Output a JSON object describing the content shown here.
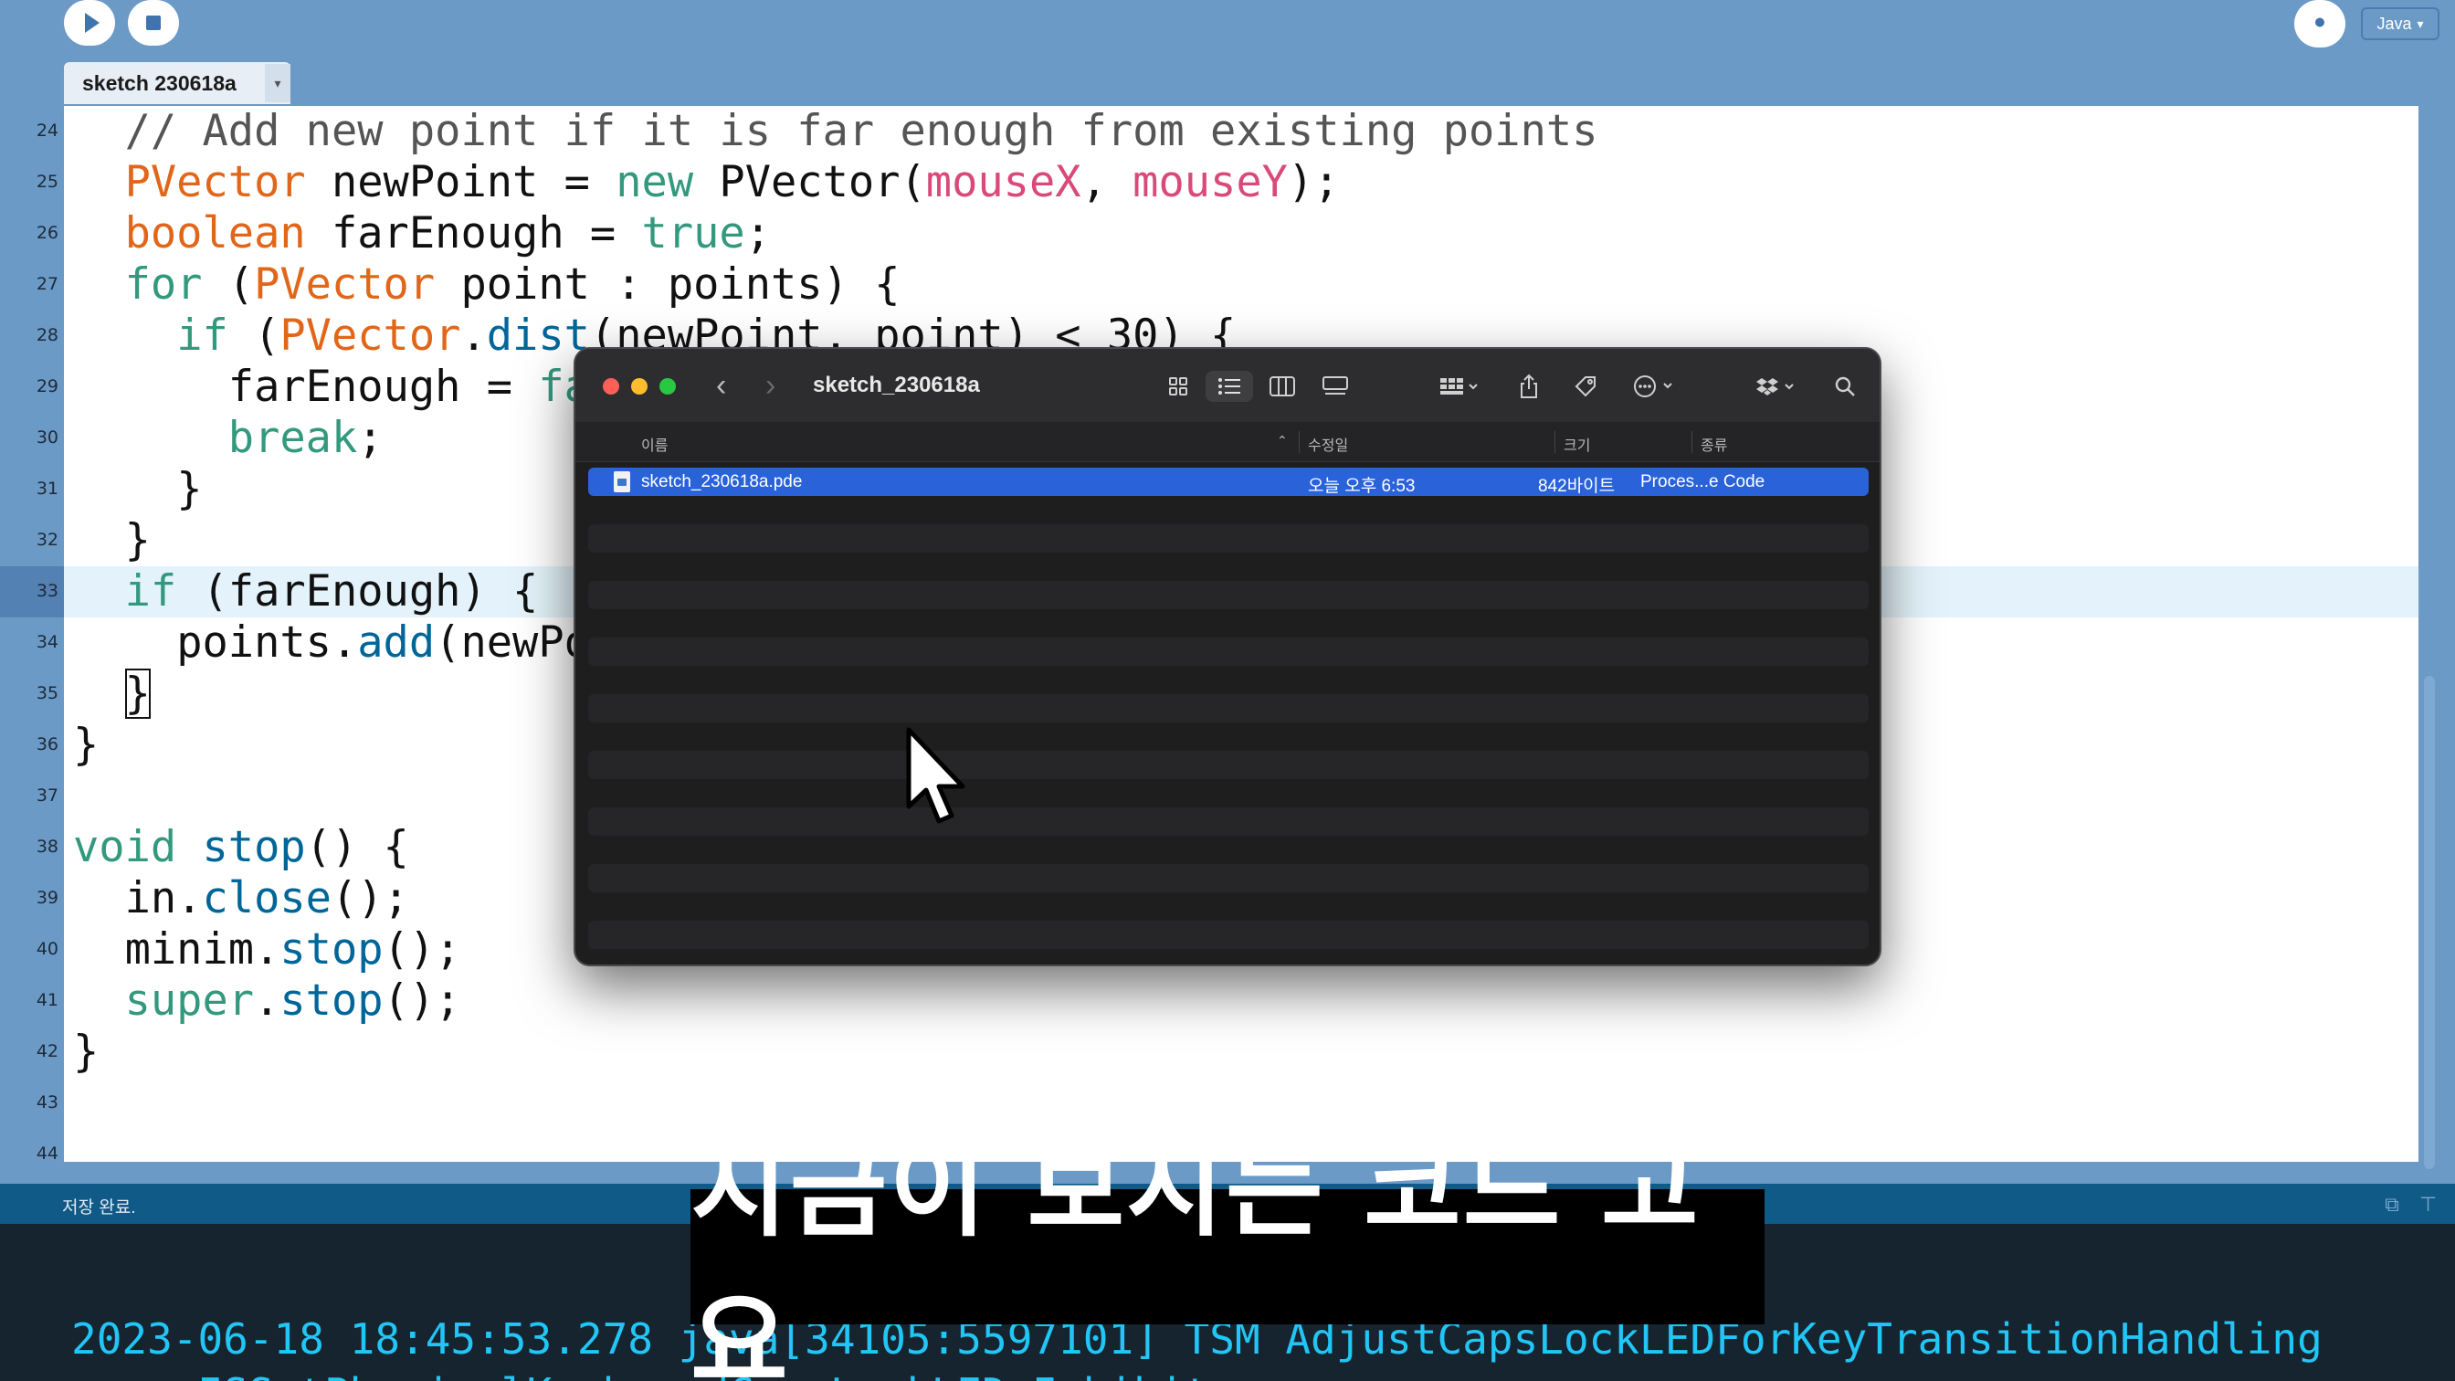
{
  "toolbar": {
    "run_icon": "play-icon",
    "stop_icon": "stop-icon",
    "debug_icon": "debugger-icon",
    "debug_glyph": "ꔷ",
    "mode_label": "Java",
    "mode_arrow": "▾"
  },
  "tab": {
    "label": "sketch 230618a",
    "arrow": "▾"
  },
  "editor": {
    "lines": [
      {
        "num": "24",
        "indent": 2,
        "tokens": [
          [
            "cmt",
            "// Add new point if it is far enough from existing points"
          ]
        ]
      },
      {
        "num": "25",
        "indent": 2,
        "tokens": [
          [
            "type",
            "PVector"
          ],
          [
            "plain",
            " newPoint = "
          ],
          [
            "kw",
            "new"
          ],
          [
            "plain",
            " PVector("
          ],
          [
            "var",
            "mouseX"
          ],
          [
            "plain",
            ", "
          ],
          [
            "var",
            "mouseY"
          ],
          [
            "plain",
            ");"
          ]
        ]
      },
      {
        "num": "26",
        "indent": 2,
        "tokens": [
          [
            "type",
            "boolean"
          ],
          [
            "plain",
            " farEnough = "
          ],
          [
            "kw",
            "true"
          ],
          [
            "plain",
            ";"
          ]
        ]
      },
      {
        "num": "27",
        "indent": 2,
        "tokens": [
          [
            "kw",
            "for"
          ],
          [
            "plain",
            " ("
          ],
          [
            "type",
            "PVector"
          ],
          [
            "plain",
            " point : points) {"
          ]
        ]
      },
      {
        "num": "28",
        "indent": 4,
        "tokens": [
          [
            "kw",
            "if"
          ],
          [
            "plain",
            " ("
          ],
          [
            "type",
            "PVector"
          ],
          [
            "plain",
            "."
          ],
          [
            "fn",
            "dist"
          ],
          [
            "plain",
            "(newPoint, point) < 30) {"
          ]
        ]
      },
      {
        "num": "29",
        "indent": 6,
        "tokens": [
          [
            "plain",
            "farEnough = "
          ],
          [
            "kw",
            "false"
          ],
          [
            "plain",
            ";"
          ]
        ]
      },
      {
        "num": "30",
        "indent": 6,
        "tokens": [
          [
            "kw",
            "break"
          ],
          [
            "plain",
            ";"
          ]
        ]
      },
      {
        "num": "31",
        "indent": 4,
        "tokens": [
          [
            "plain",
            "}"
          ]
        ]
      },
      {
        "num": "32",
        "indent": 2,
        "tokens": [
          [
            "plain",
            "}"
          ]
        ]
      },
      {
        "num": "33",
        "indent": 2,
        "current": true,
        "tokens": [
          [
            "kw",
            "if"
          ],
          [
            "plain",
            " (farEnough) {"
          ]
        ]
      },
      {
        "num": "34",
        "indent": 4,
        "tokens": [
          [
            "plain",
            "points."
          ],
          [
            "fn",
            "add"
          ],
          [
            "plain",
            "(newPoint);"
          ]
        ]
      },
      {
        "num": "35",
        "indent": 2,
        "cursor": true,
        "tokens": [
          [
            "plain",
            "}"
          ]
        ]
      },
      {
        "num": "36",
        "indent": 0,
        "tokens": [
          [
            "plain",
            "}"
          ]
        ]
      },
      {
        "num": "37",
        "indent": 0,
        "tokens": []
      },
      {
        "num": "38",
        "indent": 0,
        "tokens": [
          [
            "kw",
            "void"
          ],
          [
            "plain",
            " "
          ],
          [
            "fn",
            "stop"
          ],
          [
            "plain",
            "() {"
          ]
        ]
      },
      {
        "num": "39",
        "indent": 2,
        "tokens": [
          [
            "plain",
            "in."
          ],
          [
            "fn",
            "close"
          ],
          [
            "plain",
            "();"
          ]
        ]
      },
      {
        "num": "40",
        "indent": 2,
        "tokens": [
          [
            "plain",
            "minim."
          ],
          [
            "fn",
            "stop"
          ],
          [
            "plain",
            "();"
          ]
        ]
      },
      {
        "num": "41",
        "indent": 2,
        "tokens": [
          [
            "kw",
            "super"
          ],
          [
            "plain",
            "."
          ],
          [
            "fn",
            "stop"
          ],
          [
            "plain",
            "();"
          ]
        ]
      },
      {
        "num": "42",
        "indent": 0,
        "tokens": [
          [
            "plain",
            "}"
          ]
        ]
      },
      {
        "num": "43",
        "indent": 0,
        "tokens": []
      },
      {
        "num": "44",
        "indent": 0,
        "tokens": []
      }
    ]
  },
  "status": {
    "text": "저장 완료."
  },
  "console": {
    "lines": [
      "2023-06-18 18:45:53.278 java[34105:5597101] TSM AdjustCapsLockLEDForKeyTransitionHandling",
      "  - _ISSetPhysicalKeyboardCapsLockLED Inhibit"
    ]
  },
  "subtitle": "지금이 보시는 코드 고요",
  "finder": {
    "title": "sketch_230618a",
    "back": "‹",
    "forward": "›",
    "columns": {
      "name": "이름",
      "modified": "수정일",
      "size": "크기",
      "kind": "종류",
      "sort_arrow": "⌃"
    },
    "files": [
      {
        "name": "sketch_230618a.pde",
        "modified": "오늘 오후 6:53",
        "size": "842바이트",
        "kind": "Proces...e Code",
        "selected": true
      }
    ],
    "toolbar_icons": [
      "icon-view-icon",
      "list-view-icon",
      "column-view-icon",
      "gallery-view-icon",
      "group-icon",
      "share-icon",
      "tag-icon",
      "more-actions-icon",
      "dropbox-icon",
      "search-icon"
    ]
  },
  "colors": {
    "toolbar_bg": "#6b9ac6",
    "keyword": "#33997e",
    "type": "#e2661a",
    "variable": "#d94a7a",
    "function": "#006699",
    "console_text": "#21c6f6",
    "finder_selection": "#2962d9"
  }
}
